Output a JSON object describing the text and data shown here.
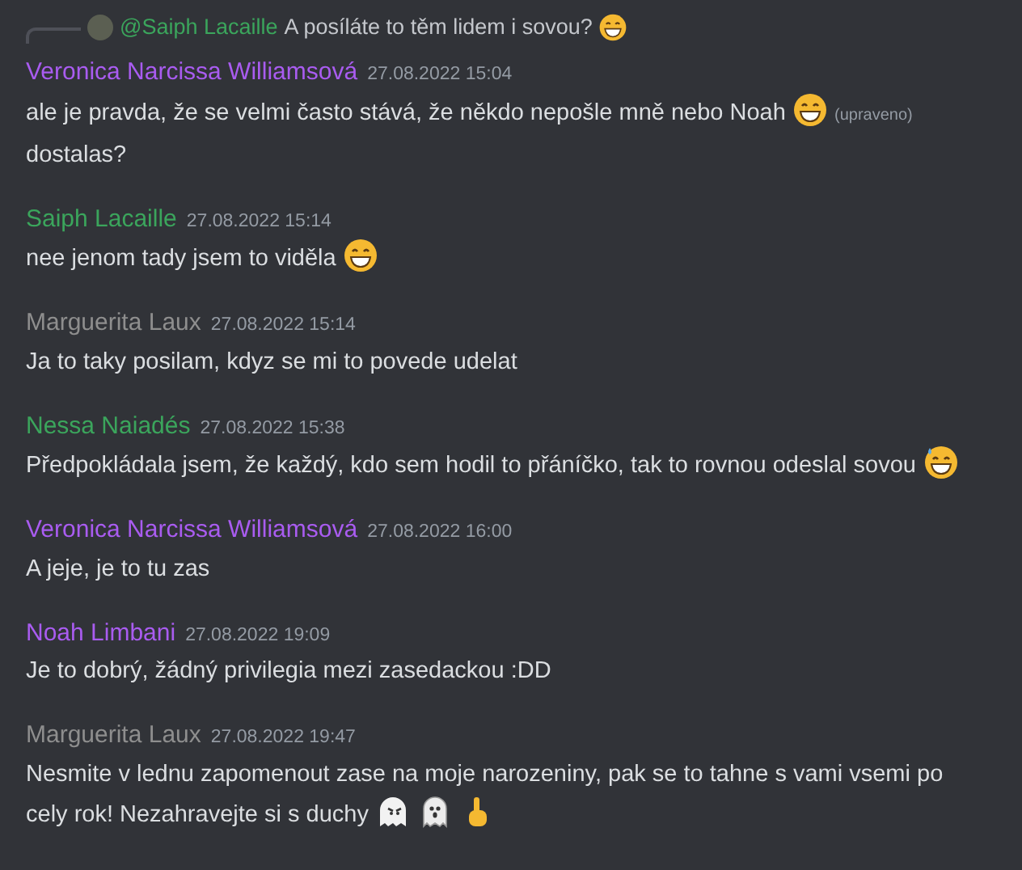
{
  "reply_preview": {
    "mention": "@Saiph Lacaille",
    "parts": [
      {
        "kind": "text",
        "text": "A posíláte to těm lidem i sovou?"
      },
      {
        "kind": "grin"
      }
    ]
  },
  "messages": [
    {
      "author": "Veronica Narcissa Williamsová",
      "color": "#a95cf0",
      "time": "27.08.2022 15:04",
      "parts": [
        {
          "kind": "text",
          "text": "ale je pravda, že se velmi často stává, že někdo nepošle mně nebo Noah"
        },
        {
          "kind": "grin"
        },
        {
          "kind": "edited",
          "text": "(upraveno)"
        },
        {
          "kind": "break"
        },
        {
          "kind": "text",
          "text": "dostalas?"
        }
      ]
    },
    {
      "author": "Saiph Lacaille",
      "color": "#3ba55c",
      "time": "27.08.2022 15:14",
      "parts": [
        {
          "kind": "text",
          "text": "nee jenom tady jsem to viděla"
        },
        {
          "kind": "grin"
        }
      ]
    },
    {
      "author": "Marguerita Laux",
      "color": "#8e8e8e",
      "time": "27.08.2022 15:14",
      "parts": [
        {
          "kind": "text",
          "text": "Ja to taky posilam, kdyz se mi to povede udelat"
        }
      ]
    },
    {
      "author": "Nessa Naiadés",
      "color": "#3ba55c",
      "time": "27.08.2022 15:38",
      "parts": [
        {
          "kind": "text",
          "text": "Předpokládala jsem, že každý, kdo sem hodil to přáníčko, tak to rovnou odeslal sovou"
        },
        {
          "kind": "sweat"
        }
      ]
    },
    {
      "author": "Veronica Narcissa Williamsová",
      "color": "#a95cf0",
      "time": "27.08.2022 16:00",
      "parts": [
        {
          "kind": "text",
          "text": "A jeje, je to tu zas"
        }
      ]
    },
    {
      "author": "Noah Limbani",
      "color": "#a95cf0",
      "time": "27.08.2022 19:09",
      "parts": [
        {
          "kind": "text",
          "text": "Je to dobrý, žádný privilegia mezi zasedackou :DD"
        }
      ]
    },
    {
      "author": "Marguerita Laux",
      "color": "#8e8e8e",
      "time": "27.08.2022 19:47",
      "parts": [
        {
          "kind": "text",
          "text": "Nesmite v lednu zapomenout zase na moje narozeniny, pak se to tahne s vami vsemi po"
        },
        {
          "kind": "break"
        },
        {
          "kind": "text",
          "text": "cely rok! Nezahravejte si s duchy"
        },
        {
          "kind": "angry-ghost"
        },
        {
          "kind": "ghost"
        },
        {
          "kind": "point"
        }
      ]
    }
  ]
}
